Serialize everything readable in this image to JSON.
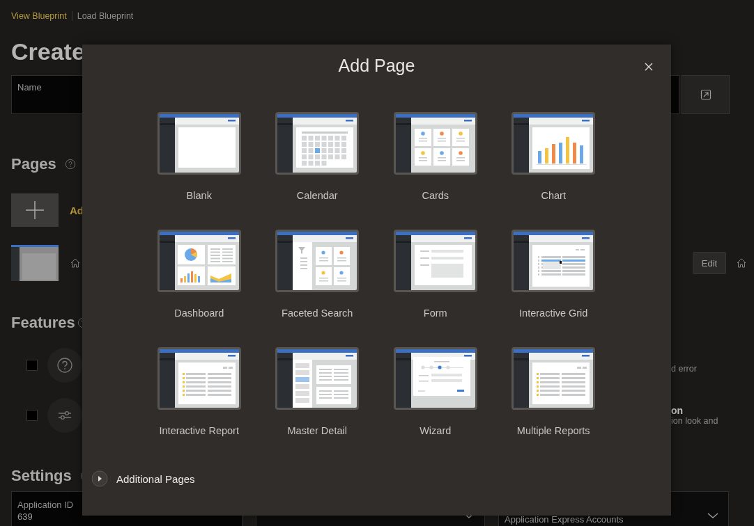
{
  "background": {
    "breadcrumbs": [
      {
        "label": "View Blueprint",
        "selected": true
      },
      {
        "label": "Load Blueprint",
        "selected": false
      }
    ],
    "title": "Create",
    "name_field": {
      "label": "Name"
    },
    "pages": {
      "heading": "Pages",
      "add_label": "Ad",
      "edit_button": "Edit"
    },
    "features": {
      "heading": "Features",
      "items": [
        {
          "kind": "help",
          "checked": false,
          "texts": [
            {
              "kind": "description",
              "text": "d error"
            }
          ]
        },
        {
          "kind": "sliders",
          "checked": false,
          "texts": [
            {
              "kind": "title",
              "text": "on"
            },
            {
              "kind": "description",
              "text": "ion look and"
            }
          ]
        }
      ]
    },
    "settings": {
      "heading": "Settings",
      "fields": [
        {
          "kind": "text",
          "label": "Application ID",
          "value": "639"
        },
        {
          "kind": "select"
        },
        {
          "kind": "select",
          "value": "Application Express Accounts"
        }
      ]
    }
  },
  "dialog": {
    "title": "Add Page",
    "templates": [
      {
        "kind": "blank",
        "label": "Blank"
      },
      {
        "kind": "calendar",
        "label": "Calendar"
      },
      {
        "kind": "cards",
        "label": "Cards"
      },
      {
        "kind": "chart",
        "label": "Chart"
      },
      {
        "kind": "dashboard",
        "label": "Dashboard"
      },
      {
        "kind": "faceted",
        "label": "Faceted Search"
      },
      {
        "kind": "form",
        "label": "Form"
      },
      {
        "kind": "grid",
        "label": "Interactive Grid"
      },
      {
        "kind": "report",
        "label": "Interactive Report"
      },
      {
        "kind": "master",
        "label": "Master Detail"
      },
      {
        "kind": "wizard",
        "label": "Wizard"
      },
      {
        "kind": "report",
        "label": "Multiple Reports"
      }
    ],
    "additional": {
      "label": "Additional Pages",
      "expanded": false
    }
  }
}
